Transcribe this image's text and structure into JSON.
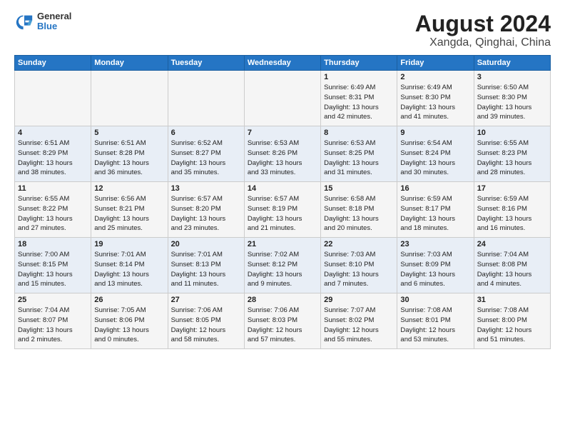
{
  "header": {
    "logo_general": "General",
    "logo_blue": "Blue",
    "title": "August 2024",
    "subtitle": "Xangda, Qinghai, China"
  },
  "weekdays": [
    "Sunday",
    "Monday",
    "Tuesday",
    "Wednesday",
    "Thursday",
    "Friday",
    "Saturday"
  ],
  "weeks": [
    [
      {
        "day": "",
        "info": ""
      },
      {
        "day": "",
        "info": ""
      },
      {
        "day": "",
        "info": ""
      },
      {
        "day": "",
        "info": ""
      },
      {
        "day": "1",
        "info": "Sunrise: 6:49 AM\nSunset: 8:31 PM\nDaylight: 13 hours\nand 42 minutes."
      },
      {
        "day": "2",
        "info": "Sunrise: 6:49 AM\nSunset: 8:30 PM\nDaylight: 13 hours\nand 41 minutes."
      },
      {
        "day": "3",
        "info": "Sunrise: 6:50 AM\nSunset: 8:30 PM\nDaylight: 13 hours\nand 39 minutes."
      }
    ],
    [
      {
        "day": "4",
        "info": "Sunrise: 6:51 AM\nSunset: 8:29 PM\nDaylight: 13 hours\nand 38 minutes."
      },
      {
        "day": "5",
        "info": "Sunrise: 6:51 AM\nSunset: 8:28 PM\nDaylight: 13 hours\nand 36 minutes."
      },
      {
        "day": "6",
        "info": "Sunrise: 6:52 AM\nSunset: 8:27 PM\nDaylight: 13 hours\nand 35 minutes."
      },
      {
        "day": "7",
        "info": "Sunrise: 6:53 AM\nSunset: 8:26 PM\nDaylight: 13 hours\nand 33 minutes."
      },
      {
        "day": "8",
        "info": "Sunrise: 6:53 AM\nSunset: 8:25 PM\nDaylight: 13 hours\nand 31 minutes."
      },
      {
        "day": "9",
        "info": "Sunrise: 6:54 AM\nSunset: 8:24 PM\nDaylight: 13 hours\nand 30 minutes."
      },
      {
        "day": "10",
        "info": "Sunrise: 6:55 AM\nSunset: 8:23 PM\nDaylight: 13 hours\nand 28 minutes."
      }
    ],
    [
      {
        "day": "11",
        "info": "Sunrise: 6:55 AM\nSunset: 8:22 PM\nDaylight: 13 hours\nand 27 minutes."
      },
      {
        "day": "12",
        "info": "Sunrise: 6:56 AM\nSunset: 8:21 PM\nDaylight: 13 hours\nand 25 minutes."
      },
      {
        "day": "13",
        "info": "Sunrise: 6:57 AM\nSunset: 8:20 PM\nDaylight: 13 hours\nand 23 minutes."
      },
      {
        "day": "14",
        "info": "Sunrise: 6:57 AM\nSunset: 8:19 PM\nDaylight: 13 hours\nand 21 minutes."
      },
      {
        "day": "15",
        "info": "Sunrise: 6:58 AM\nSunset: 8:18 PM\nDaylight: 13 hours\nand 20 minutes."
      },
      {
        "day": "16",
        "info": "Sunrise: 6:59 AM\nSunset: 8:17 PM\nDaylight: 13 hours\nand 18 minutes."
      },
      {
        "day": "17",
        "info": "Sunrise: 6:59 AM\nSunset: 8:16 PM\nDaylight: 13 hours\nand 16 minutes."
      }
    ],
    [
      {
        "day": "18",
        "info": "Sunrise: 7:00 AM\nSunset: 8:15 PM\nDaylight: 13 hours\nand 15 minutes."
      },
      {
        "day": "19",
        "info": "Sunrise: 7:01 AM\nSunset: 8:14 PM\nDaylight: 13 hours\nand 13 minutes."
      },
      {
        "day": "20",
        "info": "Sunrise: 7:01 AM\nSunset: 8:13 PM\nDaylight: 13 hours\nand 11 minutes."
      },
      {
        "day": "21",
        "info": "Sunrise: 7:02 AM\nSunset: 8:12 PM\nDaylight: 13 hours\nand 9 minutes."
      },
      {
        "day": "22",
        "info": "Sunrise: 7:03 AM\nSunset: 8:10 PM\nDaylight: 13 hours\nand 7 minutes."
      },
      {
        "day": "23",
        "info": "Sunrise: 7:03 AM\nSunset: 8:09 PM\nDaylight: 13 hours\nand 6 minutes."
      },
      {
        "day": "24",
        "info": "Sunrise: 7:04 AM\nSunset: 8:08 PM\nDaylight: 13 hours\nand 4 minutes."
      }
    ],
    [
      {
        "day": "25",
        "info": "Sunrise: 7:04 AM\nSunset: 8:07 PM\nDaylight: 13 hours\nand 2 minutes."
      },
      {
        "day": "26",
        "info": "Sunrise: 7:05 AM\nSunset: 8:06 PM\nDaylight: 13 hours\nand 0 minutes."
      },
      {
        "day": "27",
        "info": "Sunrise: 7:06 AM\nSunset: 8:05 PM\nDaylight: 12 hours\nand 58 minutes."
      },
      {
        "day": "28",
        "info": "Sunrise: 7:06 AM\nSunset: 8:03 PM\nDaylight: 12 hours\nand 57 minutes."
      },
      {
        "day": "29",
        "info": "Sunrise: 7:07 AM\nSunset: 8:02 PM\nDaylight: 12 hours\nand 55 minutes."
      },
      {
        "day": "30",
        "info": "Sunrise: 7:08 AM\nSunset: 8:01 PM\nDaylight: 12 hours\nand 53 minutes."
      },
      {
        "day": "31",
        "info": "Sunrise: 7:08 AM\nSunset: 8:00 PM\nDaylight: 12 hours\nand 51 minutes."
      }
    ]
  ]
}
